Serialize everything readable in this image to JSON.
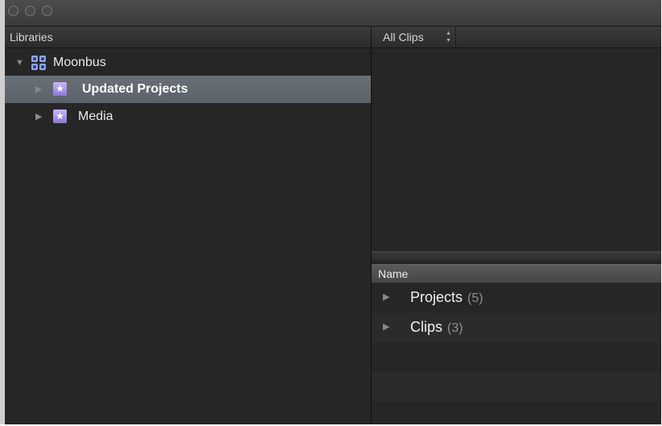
{
  "window": {
    "controls": [
      "close",
      "minimize",
      "zoom"
    ]
  },
  "libraries_pane": {
    "header": "Libraries",
    "library": {
      "name": "Moonbus",
      "icon": "library-icon",
      "expanded": true
    },
    "events": [
      {
        "name": "Updated Projects",
        "icon": "event-star-icon",
        "selected": true
      },
      {
        "name": "Media",
        "icon": "event-star-icon",
        "selected": false
      }
    ]
  },
  "browser_pane": {
    "filter": {
      "selected": "All Clips"
    },
    "list": {
      "column_header": "Name",
      "rows": [
        {
          "label": "Projects",
          "count": "(5)"
        },
        {
          "label": "Clips",
          "count": "(3)"
        }
      ]
    }
  },
  "colors": {
    "selection": "#646a72",
    "background": "#262626",
    "event_icon": "#a993e6"
  }
}
